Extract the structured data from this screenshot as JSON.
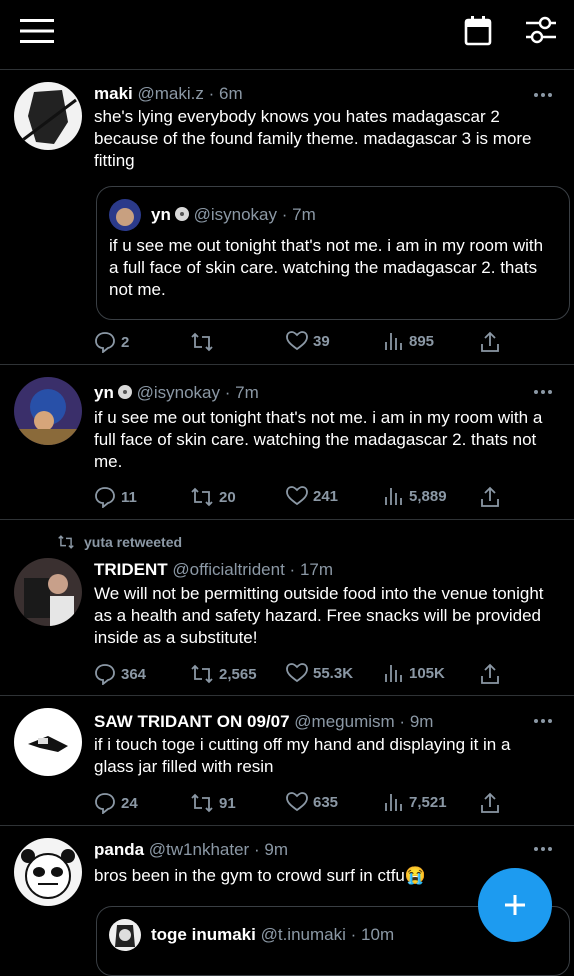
{
  "tweets": [
    {
      "name": "maki",
      "handle": "@maki.z",
      "time": "6m",
      "text": "she's lying everybody knows you hates madagascar 2 because of the found family theme. madagascar 3 is more fitting",
      "quote": {
        "name": "yn",
        "handle": "@isynokay",
        "time": "7m",
        "text": "if u see me out tonight that's not me. i am in my room with a full face of skin care. watching the madagascar 2. thats not me."
      },
      "replies": "2",
      "retweets": "",
      "likes": "39",
      "views": "895"
    },
    {
      "name": "yn",
      "handle": "@isynokay",
      "time": "7m",
      "text": "if u see me out tonight that's not me. i am in my room with a full face of skin care. watching the madagascar 2. thats not me.",
      "replies": "11",
      "retweets": "20",
      "likes": "241",
      "views": "5,889"
    },
    {
      "retweeted_by": "yuta retweeted",
      "name": "TRIDENT",
      "handle": "@officialtrident",
      "time": "17m",
      "text": "We will not be permitting outside food into the venue tonight as a health and safety hazard. Free snacks will be provided inside as a substitute!",
      "replies": "364",
      "retweets": "2,565",
      "likes": "55.3K",
      "views": "105K"
    },
    {
      "name": "SAW TRIDANT ON 09/07",
      "handle": "@megumism",
      "time": "9m",
      "text": "if i touch toge i cutting off my hand and displaying it in a glass jar filled with resin",
      "replies": "24",
      "retweets": "91",
      "likes": "635",
      "views": "7,521"
    },
    {
      "name": "panda",
      "handle": "@tw1nkhater",
      "time": "9m",
      "text": "bros been in the gym to crowd surf in ctfu😭",
      "quote": {
        "name": "toge inumaki",
        "handle": "@t.inumaki",
        "time": "10m"
      }
    }
  ],
  "sep": "·",
  "colors": {
    "accent": "#1d9bf0",
    "muted": "#8b98a5",
    "border": "#2f3336"
  }
}
